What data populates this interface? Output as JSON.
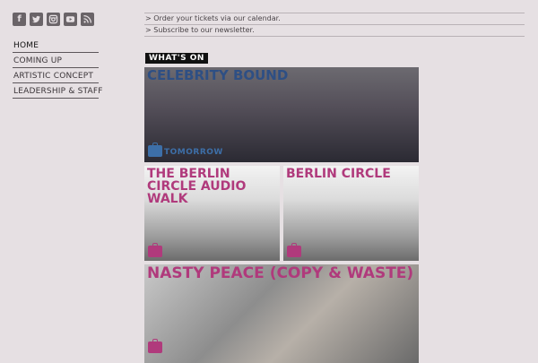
{
  "social": [
    {
      "name": "facebook-icon",
      "glyph": "f"
    },
    {
      "name": "twitter-icon",
      "glyph": ""
    },
    {
      "name": "instagram-icon",
      "glyph": ""
    },
    {
      "name": "youtube-icon",
      "glyph": ""
    },
    {
      "name": "rss-icon",
      "glyph": ""
    }
  ],
  "nav": {
    "items": [
      "HOME",
      "COMING UP",
      "ARTISTIC CONCEPT",
      "LEADERSHIP & STAFF"
    ]
  },
  "top_links": [
    "> Order your tickets via our calendar.",
    "> Subscribe to our newsletter."
  ],
  "section_label": "WHAT'S ON",
  "tiles": [
    {
      "title": "CELEBRITY BOUND",
      "when": "TOMORROW"
    },
    {
      "title": "THE BERLIN CIRCLE AUDIO WALK"
    },
    {
      "title": "BERLIN CIRCLE"
    },
    {
      "title": "NASTY PEACE (COPY & WASTE)"
    }
  ],
  "colors": {
    "background": "#e6e0e3",
    "accent_magenta": "#b03a7c",
    "accent_blue": "#3d6fa8",
    "icon_gray": "#6a6468"
  }
}
